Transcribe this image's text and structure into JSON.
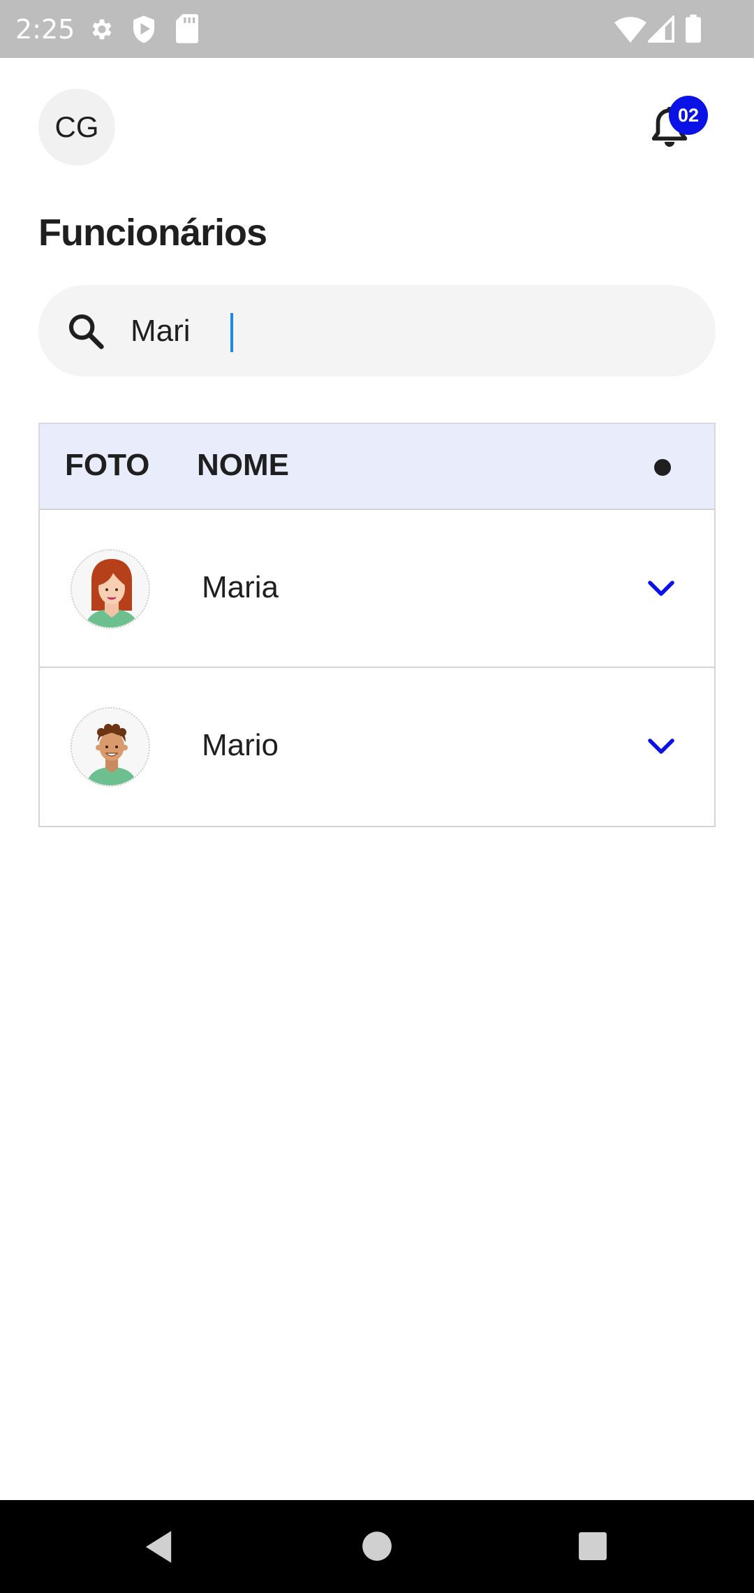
{
  "status_bar": {
    "time": "2:25",
    "left_icons": [
      "settings-icon",
      "shield-play-icon",
      "sd-card-icon"
    ],
    "right_icons": [
      "wifi-icon",
      "signal-icon",
      "battery-icon"
    ]
  },
  "header": {
    "avatar_initials": "CG",
    "notification_count": "02"
  },
  "page": {
    "title": "Funcionários"
  },
  "search": {
    "value": "Mari",
    "icon": "search-icon"
  },
  "table": {
    "headers": {
      "photo": "FOTO",
      "name": "NOME"
    },
    "rows": [
      {
        "name": "Maria",
        "photo": "female-avatar"
      },
      {
        "name": "Mario",
        "photo": "male-avatar"
      }
    ]
  },
  "colors": {
    "accent": "#0a12e6",
    "header_bg": "#e9edfb",
    "search_bg": "#f4f4f4",
    "status_bar": "#bdbdbd"
  },
  "nav_bar": {
    "buttons": [
      "back-icon",
      "home-icon",
      "recents-icon"
    ]
  }
}
